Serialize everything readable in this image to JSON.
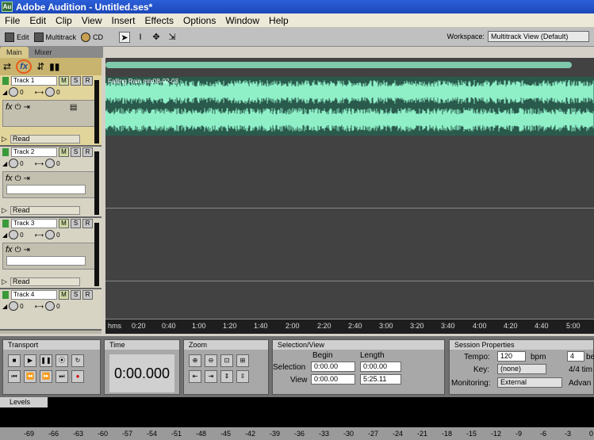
{
  "window": {
    "title": "Adobe Audition - Untitled.ses*",
    "app_icon": "Au"
  },
  "menu": [
    "File",
    "Edit",
    "Clip",
    "View",
    "Insert",
    "Effects",
    "Options",
    "Window",
    "Help"
  ],
  "toolbar": {
    "edit": "Edit",
    "multitrack": "Multitrack",
    "cd": "CD",
    "workspace_label": "Workspace:",
    "workspace_value": "Multitrack View (Default)"
  },
  "tabs": [
    "Main",
    "Mixer"
  ],
  "tracks": [
    {
      "name": "Track 1",
      "vol": "0",
      "pan": "0",
      "read": "Read"
    },
    {
      "name": "Track 2",
      "vol": "0",
      "pan": "0",
      "read": "Read"
    },
    {
      "name": "Track 3",
      "vol": "0",
      "pan": "0",
      "read": "Read"
    },
    {
      "name": "Track 4",
      "vol": "0",
      "pan": "0",
      "read": "Read"
    }
  ],
  "clip_label": "Falling Rain mix08-02-03",
  "ruler": [
    "hms",
    "0:20",
    "0:40",
    "1:00",
    "1:20",
    "1:40",
    "2:00",
    "2:20",
    "2:40",
    "3:00",
    "3:20",
    "3:40",
    "4:00",
    "4:20",
    "4:40",
    "5:00"
  ],
  "transport": {
    "title": "Transport"
  },
  "time": {
    "title": "Time",
    "value": "0:00.000"
  },
  "zoom": {
    "title": "Zoom"
  },
  "selection": {
    "title": "Selection/View",
    "begin": "Begin",
    "length": "Length",
    "sel_label": "Selection",
    "view_label": "View",
    "sel_begin": "0:00.00",
    "sel_length": "0:00.00",
    "view_begin": "0:00.00",
    "view_length": "5:25.11"
  },
  "session": {
    "title": "Session Properties",
    "tempo_label": "Tempo:",
    "tempo": "120",
    "bpm": "bpm",
    "beats": "4",
    "beats_unit": "be",
    "key_label": "Key:",
    "key": "(none)",
    "time_sig": "4/4 tim",
    "monitoring_label": "Monitoring:",
    "monitoring": "External",
    "advanced": "Advan"
  },
  "levels": {
    "title": "Levels",
    "scale": [
      "-69",
      "-66",
      "-63",
      "-60",
      "-57",
      "-54",
      "-51",
      "-48",
      "-45",
      "-42",
      "-39",
      "-36",
      "-33",
      "-30",
      "-27",
      "-24",
      "-21",
      "-18",
      "-15",
      "-12",
      "-9",
      "-6",
      "-3",
      "0"
    ]
  }
}
